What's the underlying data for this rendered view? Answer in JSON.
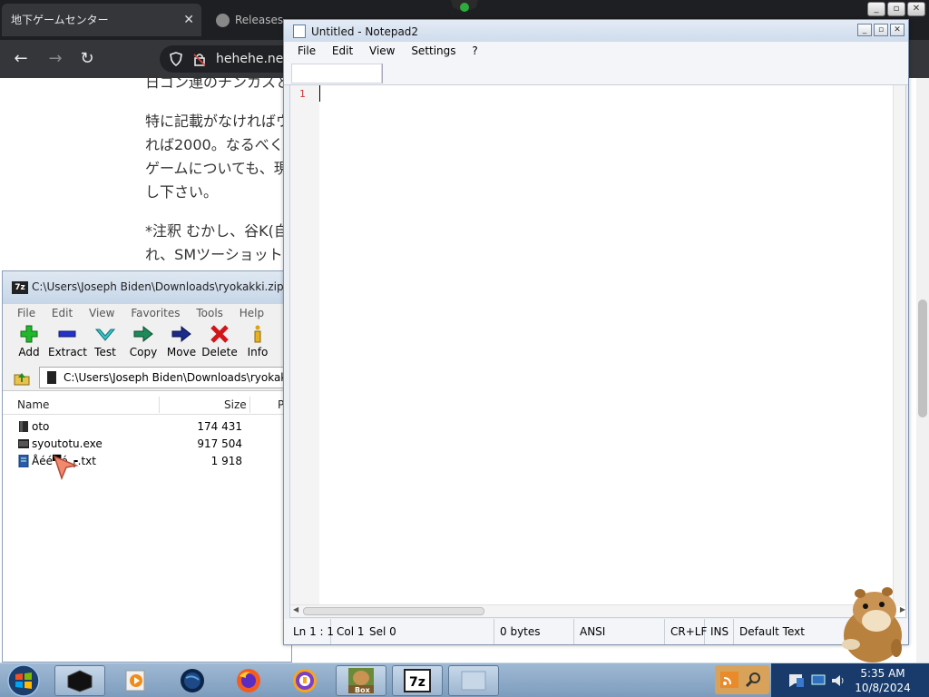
{
  "browser": {
    "tab_active": "地下ゲームセンター",
    "tab_inactive": "Releases ·",
    "url": "hehehe.net/",
    "content_lines": [
      "日ゴン連のチンカスと",
      "特に記載がなければウ",
      "れば2000。なるべく",
      "ゲームについても、現",
      "し下さい。",
      "*注釈 むかし、谷K(自",
      "れ、SMツーショット"
    ]
  },
  "sevenzip": {
    "title": "C:\\Users\\Joseph Biden\\Downloads\\ryokakki.zip\\boue",
    "menu": [
      "File",
      "Edit",
      "View",
      "Favorites",
      "Tools",
      "Help"
    ],
    "toolbar": [
      {
        "label": "Add",
        "icon": "plus-icon"
      },
      {
        "label": "Extract",
        "icon": "minus-icon"
      },
      {
        "label": "Test",
        "icon": "check-icon"
      },
      {
        "label": "Copy",
        "icon": "copy-arrow-icon"
      },
      {
        "label": "Move",
        "icon": "move-arrow-icon"
      },
      {
        "label": "Delete",
        "icon": "delete-x-icon"
      },
      {
        "label": "Info",
        "icon": "info-icon"
      }
    ],
    "address": "C:\\Users\\Joseph Biden\\Downloads\\ryokakki.zip",
    "columns": {
      "name": "Name",
      "size": "Size",
      "packed": "P"
    },
    "files": [
      {
        "name": "oto",
        "size": "174 431",
        "icon": "folder-icon"
      },
      {
        "name": "syoutotu.exe",
        "size": "917 504",
        "icon": "exe-icon"
      },
      {
        "name": "Åéé▀é ┍.txt",
        "size": "1 918",
        "icon": "text-file-icon"
      }
    ]
  },
  "notepad": {
    "title": "Untitled - Notepad2",
    "menu": [
      "File",
      "Edit",
      "View",
      "Settings",
      "?"
    ],
    "line_number": "1",
    "status": {
      "position": "Ln 1 : 1",
      "col": "Col 1",
      "sel": "Sel 0",
      "bytes": "0 bytes",
      "encoding": "ANSI",
      "eol": "CR+LF",
      "mode": "INS",
      "scheme": "Default Text"
    }
  },
  "taskbar": {
    "time": "5:35 AM",
    "date": "10/8/2024",
    "box_label": "Box"
  }
}
